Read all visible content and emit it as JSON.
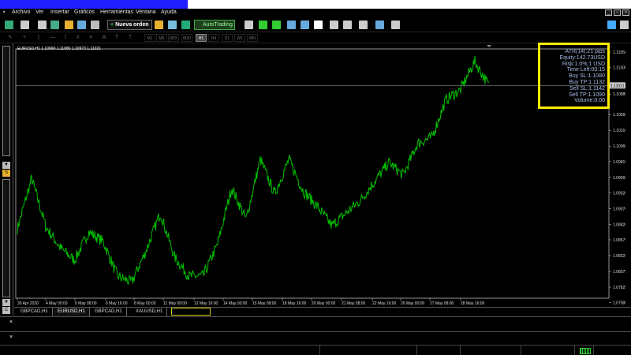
{
  "menu": [
    "Archivo",
    "Ver",
    "Insertar",
    "Gráficos",
    "Herramientas",
    "Ventana",
    "Ayuda"
  ],
  "toolbar": {
    "new_order": "Nueva orden",
    "auto_trading": "AutoTrading"
  },
  "timeframes": [
    "M1",
    "M5",
    "M15",
    "M30",
    "H1",
    "H4",
    "D1",
    "W1",
    "MN"
  ],
  "active_timeframe": "H1",
  "chart_header": "EURUSD,H1  1.10990 1.11080 1.10973 1.11021",
  "side_labels": {
    "s": "S",
    "c": "C"
  },
  "info": {
    "atr": "ATR(14):21 pips",
    "equity": "Equity:142.73USD",
    "risk": "Risk:1.0%:1 USD",
    "time_left": "Time Left:00:15",
    "buy_sl": "Buy SL:1.1080",
    "buy_tp": "Buy TP:1.1132",
    "sell_sl": "Sell SL:1.1142",
    "sell_tp": "Sell TP:1.1090",
    "volume": "Volume:0.00"
  },
  "tabs": [
    "GBPCAD,H1",
    "EURUSD,H1",
    "GBPCAD,H1",
    "XAUUSD,H1"
  ],
  "active_tab": 1,
  "chart_data": {
    "type": "line",
    "series": [
      {
        "color": "#00c000"
      }
    ],
    "current_price": "1.11021",
    "ylim": [
      1.0765,
      1.116
    ],
    "yticks": [
      "1.11550",
      "1.11305",
      "1.10885",
      "1.10560",
      "1.10310",
      "1.10060",
      "1.09815",
      "1.09565",
      "1.09320",
      "1.09070",
      "1.08820",
      "1.08575",
      "1.08325",
      "1.08075",
      "1.07825",
      "1.07580"
    ],
    "xticks": [
      "30 Apr 2020",
      "4 May 00:00",
      "5 May 08:00",
      "6 May 16:00",
      "8 May 00:00",
      "11 May 08:00",
      "12 May 16:00",
      "14 May 00:00",
      "15 May 08:00",
      "18 May 16:00",
      "20 May 00:00",
      "21 May 08:00",
      "22 May 16:00",
      "26 May 00:00",
      "27 May 08:00",
      "28 May 16:00"
    ],
    "anchors": [
      1.0875,
      1.0955,
      1.0878,
      1.0845,
      1.0825,
      1.087,
      1.0855,
      1.08,
      1.079,
      1.084,
      1.09,
      1.083,
      1.08,
      1.08,
      1.085,
      1.094,
      1.089,
      1.0985,
      1.093,
      1.0985,
      1.0935,
      1.091,
      1.088,
      1.09,
      1.092,
      1.095,
      1.098,
      1.096,
      1.101,
      1.102,
      1.108,
      1.1095,
      1.114,
      1.1102
    ]
  }
}
